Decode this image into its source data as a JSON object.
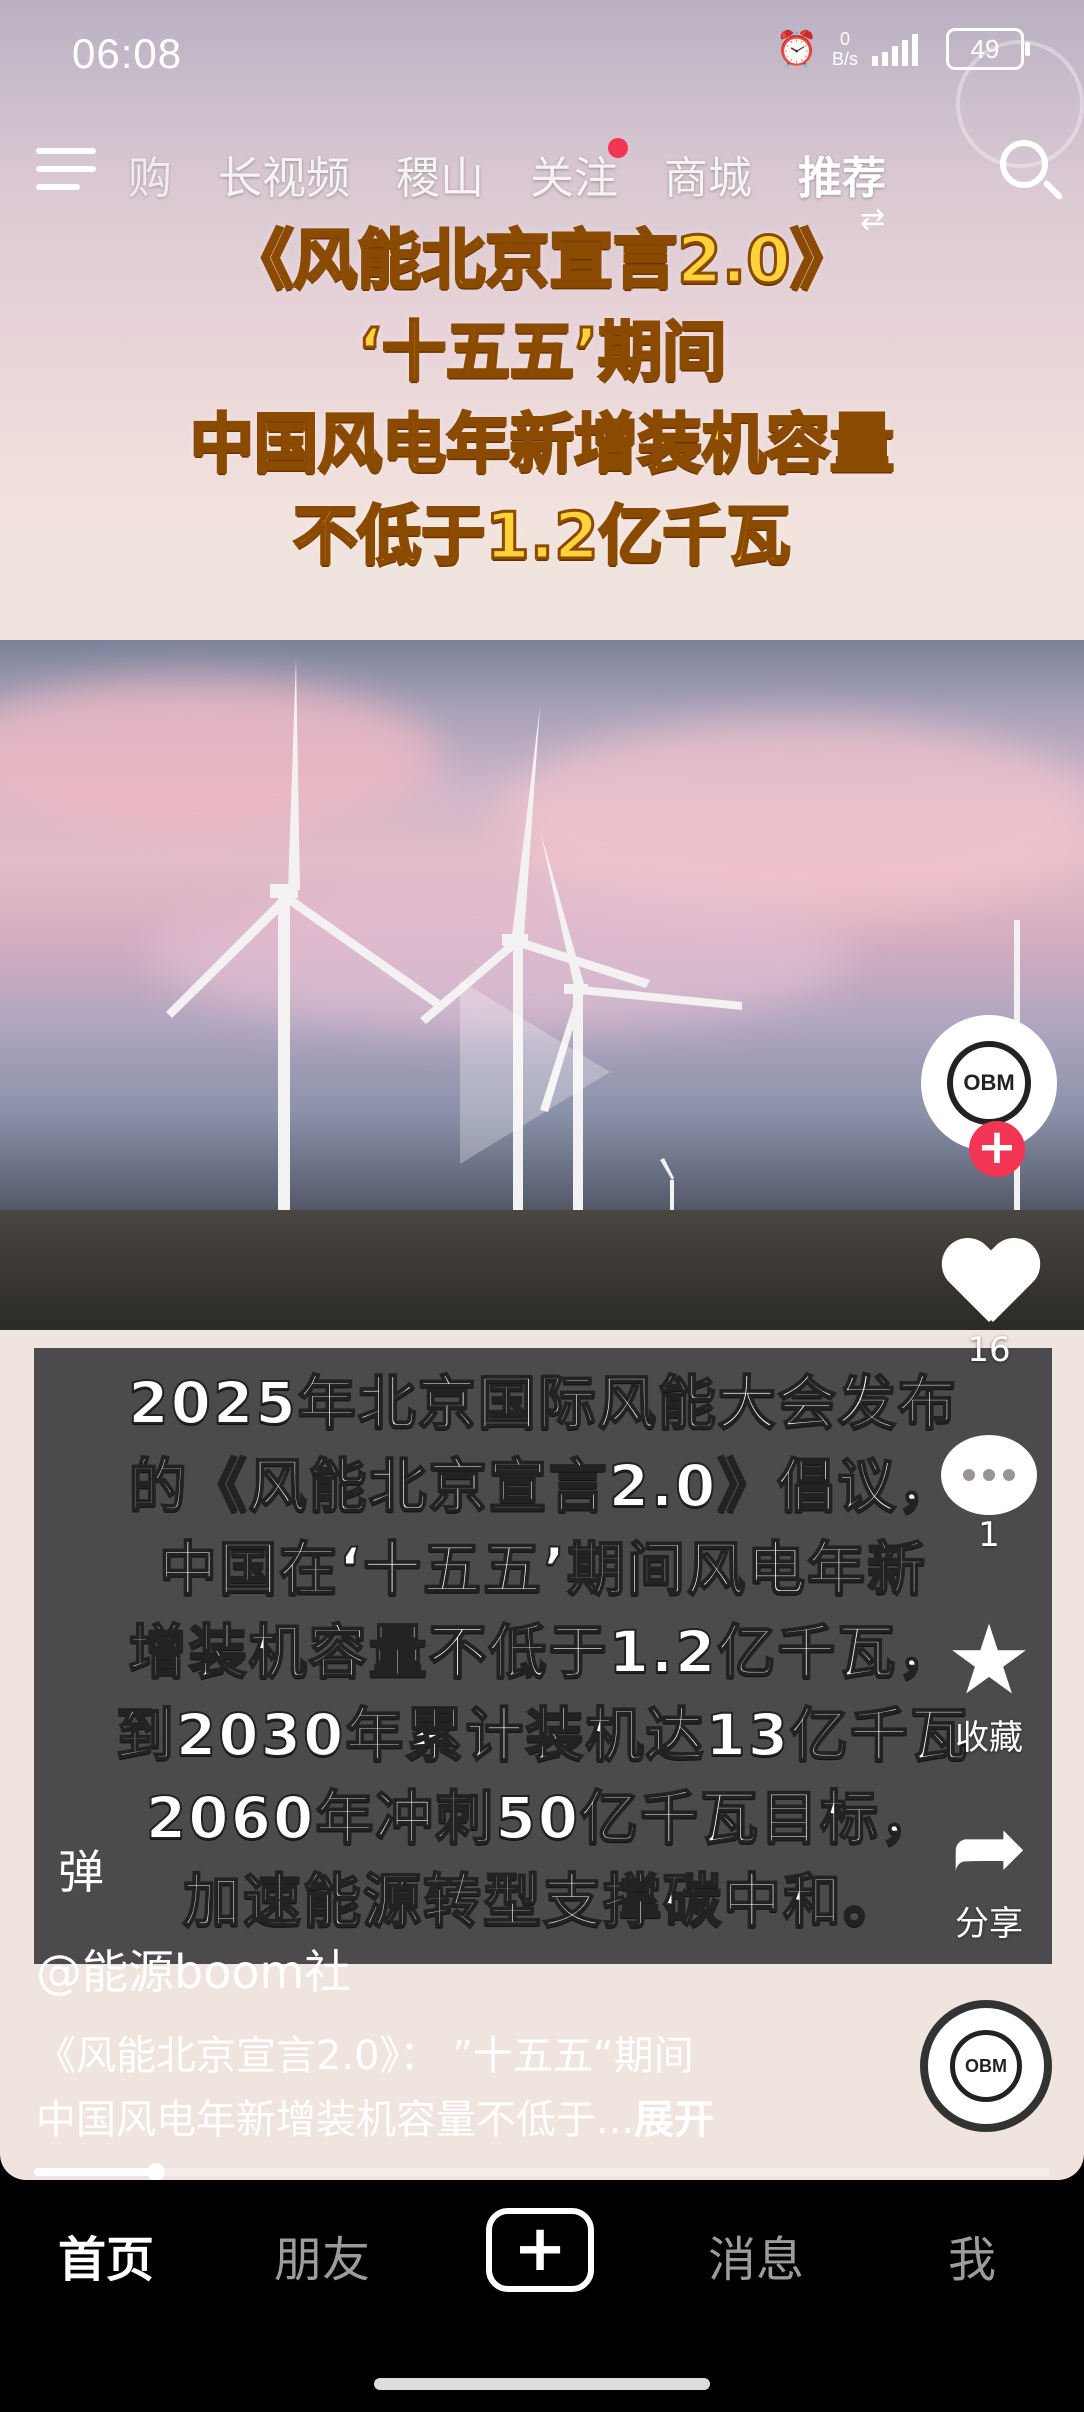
{
  "status_bar": {
    "time": "06:08",
    "net_speed_value": "0",
    "net_speed_unit": "B/s",
    "battery": "49"
  },
  "top_nav": {
    "tabs": [
      "购",
      "长视频",
      "稷山",
      "关注",
      "商城",
      "推荐"
    ],
    "active_tab": "推荐"
  },
  "video": {
    "headline": [
      "《风能北京宣言2.0》",
      "‘十五五’期间",
      "中国风电年新增装机容量",
      "不低于1.2亿千瓦"
    ],
    "body": [
      "2025年北京国际风能大会发布",
      "的《风能北京宣言2.0》倡议，",
      "中国在‘十五五’期间风电年新",
      "增装机容量不低于1.2亿千瓦，",
      "到2030年累计装机达13亿千瓦",
      "2060年冲刺50亿千瓦目标，",
      "加速能源转型支撑碳中和。"
    ],
    "progress": 0.12
  },
  "sidebar": {
    "avatar_logo": "OBM",
    "likes": "16",
    "comments": "1",
    "favorite_label": "收藏",
    "share_label": "分享"
  },
  "danmu_label": "弹",
  "author": "@能源boom社",
  "caption": {
    "line1": "《风能北京宣言2.0》： ”十五五“期间",
    "line2": "中国风电年新增装机容量不低于...",
    "more": "展开"
  },
  "bottom_nav": {
    "home": "首页",
    "friends": "朋友",
    "add": "+",
    "messages": "消息",
    "me": "我"
  }
}
